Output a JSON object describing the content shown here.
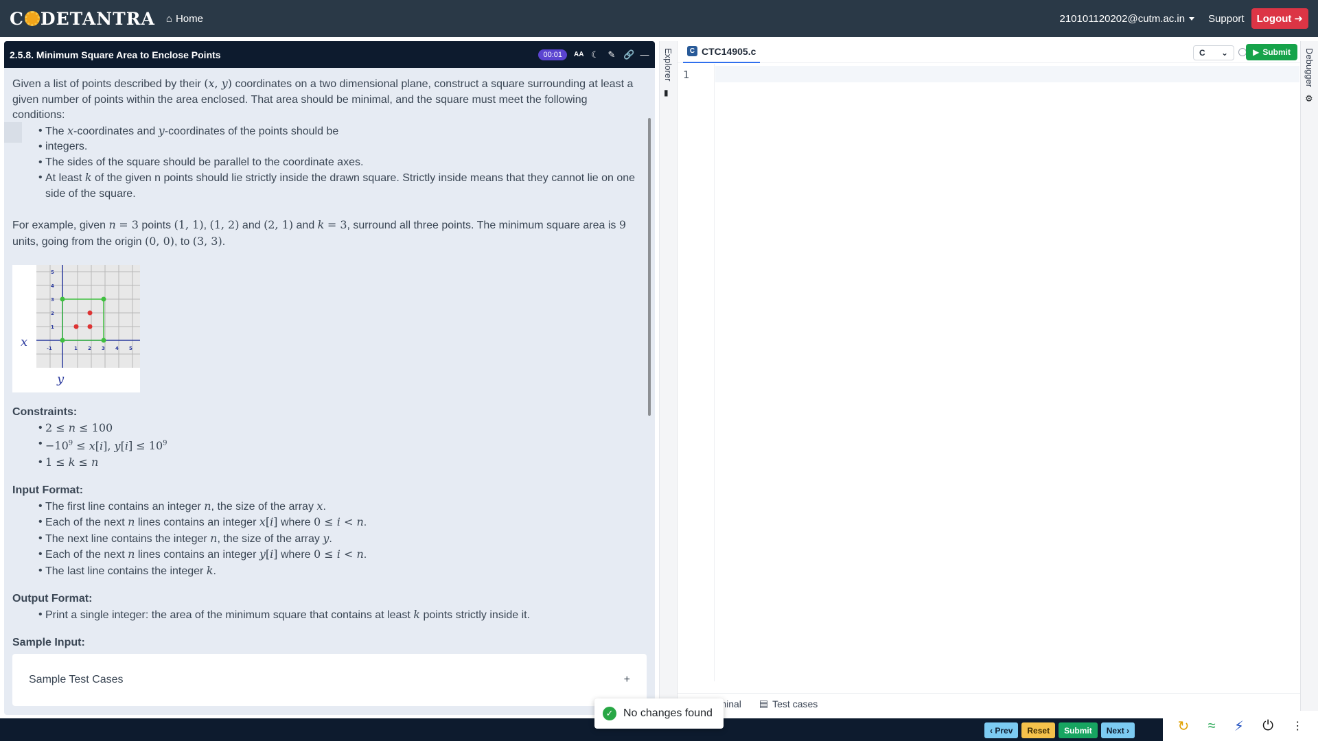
{
  "navbar": {
    "brand": "CODETANTRA",
    "home": "Home",
    "user": "210101120202@cutm.ac.in",
    "support": "Support",
    "logout": "Logout"
  },
  "question": {
    "title": "2.5.8. Minimum Square Area to Enclose Points",
    "timer": "00:01",
    "text_size_icon": "AA"
  },
  "editor": {
    "file_name": "CTC14905.c",
    "language": "C",
    "submit": "Submit",
    "line_number": "1",
    "explorer_label": "Explorer",
    "debugger_label": "Debugger",
    "terminal_tab": "Terminal",
    "testcases_tab": "Test cases"
  },
  "sample": {
    "title": "Sample Test Cases",
    "expand": "+"
  },
  "footer": {
    "prev": "Prev",
    "reset": "Reset",
    "submit": "Submit",
    "next": "Next"
  },
  "toast": {
    "message": "No changes found"
  },
  "colors": {
    "navbar": "#2a3947",
    "header": "#0d1b2e",
    "panel": "#e6ebf3",
    "logout": "#dc3545",
    "timer": "#5b44d0",
    "submit": "#16a34a"
  },
  "icons": {
    "tray": [
      "refresh-icon",
      "wifi-icon",
      "bolt-off-icon",
      "power-icon",
      "more-icon"
    ]
  }
}
